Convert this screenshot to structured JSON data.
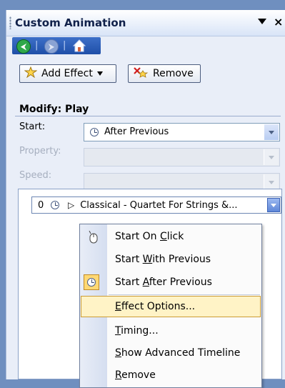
{
  "pane": {
    "title": "Custom Animation",
    "close_glyph": "×",
    "nav": {
      "back_glyph": "⮜",
      "forward_glyph": "⮞",
      "separator": "|"
    }
  },
  "toolbar": {
    "add_effect_label": "Add Effect",
    "remove_label": "Remove"
  },
  "modify": {
    "section_title": "Modify: Play",
    "start_label": "Start:",
    "start_value": "After Previous",
    "property_label": "Property:",
    "speed_label": "Speed:"
  },
  "effects_list": {
    "items": [
      {
        "index": "0",
        "name": "Classical - Quartet For Strings &..."
      }
    ]
  },
  "context_menu": {
    "start_on_click": {
      "pre": "Start On ",
      "u": "C",
      "post": "lick"
    },
    "start_with_previous": {
      "pre": "Start ",
      "u": "W",
      "post": "ith Previous"
    },
    "start_after_previous": {
      "pre": "Start ",
      "u": "A",
      "post": "fter Previous"
    },
    "effect_options": {
      "pre": "",
      "u": "E",
      "post": "ffect Options..."
    },
    "timing": {
      "pre": "",
      "u": "T",
      "post": "iming..."
    },
    "show_advanced_timeline": {
      "pre": "",
      "u": "S",
      "post": "how Advanced Timeline"
    },
    "remove": {
      "pre": "",
      "u": "R",
      "post": "emove"
    }
  },
  "colors": {
    "pane_background": "#e9eef8",
    "nav_bar": "#2a5bb7",
    "menu_highlight": "#fff3c6",
    "menu_highlight_border": "#cc9c35"
  }
}
